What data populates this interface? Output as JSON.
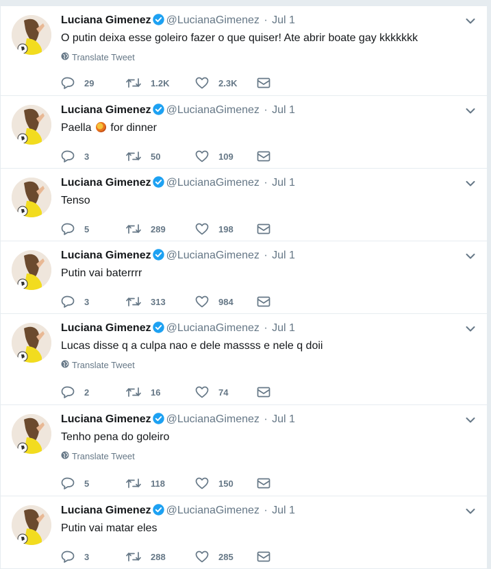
{
  "colors": {
    "text": "#14171a",
    "muted": "#657786",
    "border": "#e6ecf0",
    "verified": "#1da1f2"
  },
  "translate_label": "Translate Tweet",
  "tweets": [
    {
      "name": "Luciana Gimenez",
      "handle": "@LucianaGimenez",
      "separator": "·",
      "time": "Jul 1",
      "text": "O putin deixa esse goleiro fazer o que quiser! Ate abrir boate gay kkkkkkk",
      "has_translate": true,
      "replies": "29",
      "retweets": "1.2K",
      "likes": "2.3K"
    },
    {
      "name": "Luciana Gimenez",
      "handle": "@LucianaGimenez",
      "separator": "·",
      "time": "Jul 1",
      "text_before": "Paella",
      "text_after": "for dinner",
      "emoji": "paella-emoji",
      "has_translate": false,
      "replies": "3",
      "retweets": "50",
      "likes": "109"
    },
    {
      "name": "Luciana Gimenez",
      "handle": "@LucianaGimenez",
      "separator": "·",
      "time": "Jul 1",
      "text": "Tenso",
      "has_translate": false,
      "replies": "5",
      "retweets": "289",
      "likes": "198"
    },
    {
      "name": "Luciana Gimenez",
      "handle": "@LucianaGimenez",
      "separator": "·",
      "time": "Jul 1",
      "text": "Putin vai baterrrr",
      "has_translate": false,
      "replies": "3",
      "retweets": "313",
      "likes": "984"
    },
    {
      "name": "Luciana Gimenez",
      "handle": "@LucianaGimenez",
      "separator": "·",
      "time": "Jul 1",
      "text": "Lucas disse q a culpa nao e dele massss e nele q doii",
      "has_translate": true,
      "replies": "2",
      "retweets": "16",
      "likes": "74"
    },
    {
      "name": "Luciana Gimenez",
      "handle": "@LucianaGimenez",
      "separator": "·",
      "time": "Jul 1",
      "text": "Tenho pena do goleiro",
      "has_translate": true,
      "replies": "5",
      "retweets": "118",
      "likes": "150"
    },
    {
      "name": "Luciana Gimenez",
      "handle": "@LucianaGimenez",
      "separator": "·",
      "time": "Jul 1",
      "text": "Putin vai matar eles",
      "has_translate": false,
      "replies": "3",
      "retweets": "288",
      "likes": "285"
    }
  ]
}
